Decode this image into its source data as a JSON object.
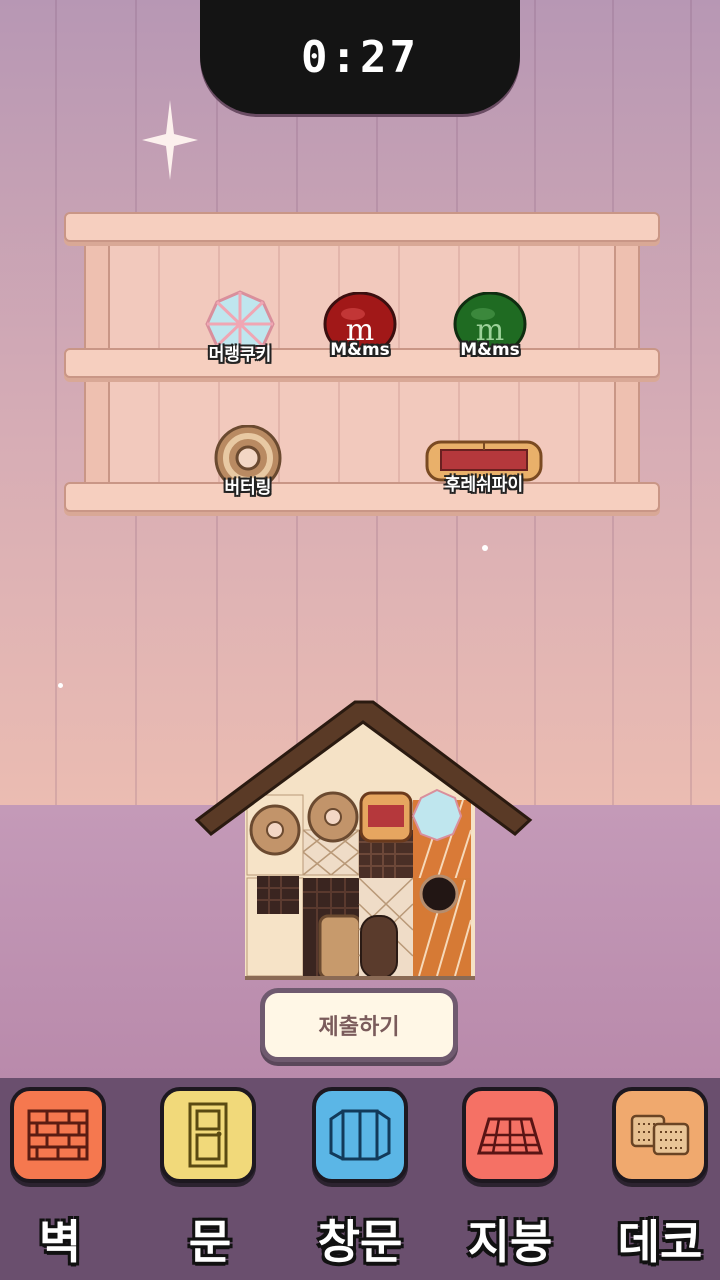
{
  "timer": {
    "text": "0:27"
  },
  "shelf": {
    "top_items": [
      {
        "label": "머랭쿠키",
        "icon": "meringue-cookie-icon"
      },
      {
        "label": "M&ms",
        "icon": "red-mms-icon",
        "mark": "m"
      },
      {
        "label": "M&ms",
        "icon": "green-mms-icon",
        "mark": "m"
      }
    ],
    "bottom_items": [
      {
        "label": "버터링",
        "icon": "butter-ring-cookie-icon"
      },
      {
        "label": "후레쉬파이",
        "icon": "fresh-pie-icon"
      }
    ]
  },
  "submit": {
    "label": "제출하기"
  },
  "tabs": [
    {
      "label": "벽",
      "icon": "brick-wall-icon",
      "color": "#f5784f"
    },
    {
      "label": "문",
      "icon": "door-icon",
      "color": "#f1d97a"
    },
    {
      "label": "창문",
      "icon": "window-icon",
      "color": "#5bb6e6"
    },
    {
      "label": "지붕",
      "icon": "roof-icon",
      "color": "#f57165"
    },
    {
      "label": "데코",
      "icon": "cracker-deco-icon",
      "color": "#f0a96e"
    }
  ]
}
